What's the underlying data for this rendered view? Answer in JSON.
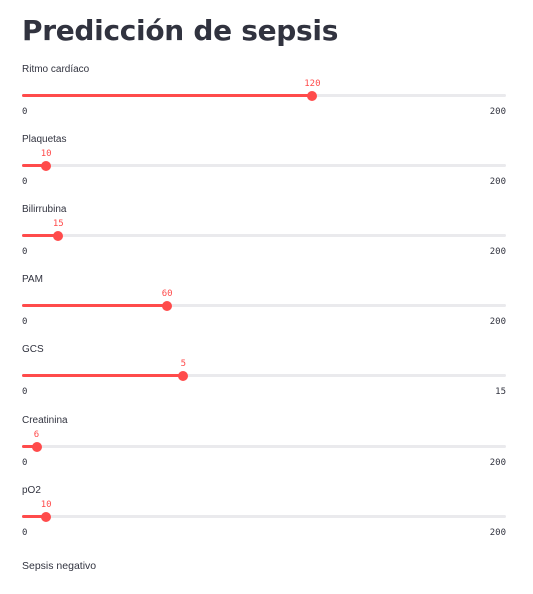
{
  "title": "Predicción de sepsis",
  "sliders": [
    {
      "label": "Ritmo cardíaco",
      "value": 120,
      "min": 0,
      "max": 200
    },
    {
      "label": "Plaquetas",
      "value": 10,
      "min": 0,
      "max": 200
    },
    {
      "label": "Bilirrubina",
      "value": 15,
      "min": 0,
      "max": 200
    },
    {
      "label": "PAM",
      "value": 60,
      "min": 0,
      "max": 200
    },
    {
      "label": "GCS",
      "value": 5,
      "min": 0,
      "max": 15
    },
    {
      "label": "Creatinina",
      "value": 6,
      "min": 0,
      "max": 200
    },
    {
      "label": "pO2",
      "value": 10,
      "min": 0,
      "max": 200
    }
  ],
  "result": "Sepsis negativo",
  "colors": {
    "accent": "#ff4b4b",
    "track": "#eaeaed",
    "text": "#31333f"
  }
}
